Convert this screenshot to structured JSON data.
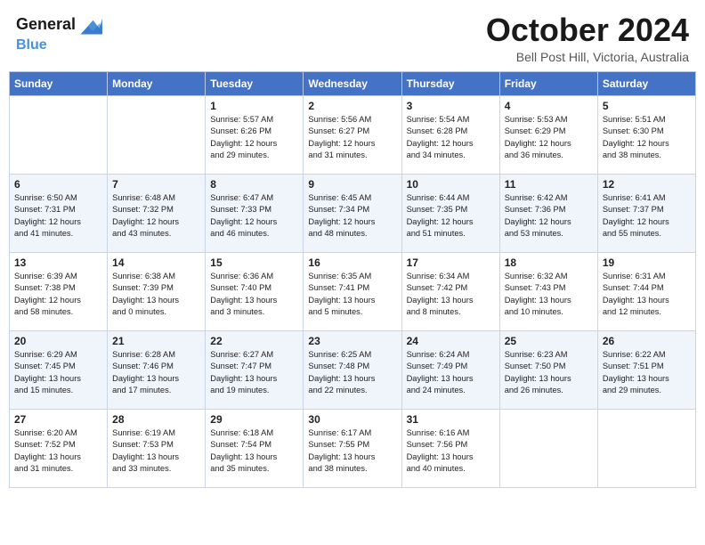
{
  "logo": {
    "line1": "General",
    "line2": "Blue"
  },
  "header": {
    "month": "October 2024",
    "location": "Bell Post Hill, Victoria, Australia"
  },
  "days_of_week": [
    "Sunday",
    "Monday",
    "Tuesday",
    "Wednesday",
    "Thursday",
    "Friday",
    "Saturday"
  ],
  "weeks": [
    [
      {
        "day": "",
        "info": ""
      },
      {
        "day": "",
        "info": ""
      },
      {
        "day": "1",
        "info": "Sunrise: 5:57 AM\nSunset: 6:26 PM\nDaylight: 12 hours\nand 29 minutes."
      },
      {
        "day": "2",
        "info": "Sunrise: 5:56 AM\nSunset: 6:27 PM\nDaylight: 12 hours\nand 31 minutes."
      },
      {
        "day": "3",
        "info": "Sunrise: 5:54 AM\nSunset: 6:28 PM\nDaylight: 12 hours\nand 34 minutes."
      },
      {
        "day": "4",
        "info": "Sunrise: 5:53 AM\nSunset: 6:29 PM\nDaylight: 12 hours\nand 36 minutes."
      },
      {
        "day": "5",
        "info": "Sunrise: 5:51 AM\nSunset: 6:30 PM\nDaylight: 12 hours\nand 38 minutes."
      }
    ],
    [
      {
        "day": "6",
        "info": "Sunrise: 6:50 AM\nSunset: 7:31 PM\nDaylight: 12 hours\nand 41 minutes."
      },
      {
        "day": "7",
        "info": "Sunrise: 6:48 AM\nSunset: 7:32 PM\nDaylight: 12 hours\nand 43 minutes."
      },
      {
        "day": "8",
        "info": "Sunrise: 6:47 AM\nSunset: 7:33 PM\nDaylight: 12 hours\nand 46 minutes."
      },
      {
        "day": "9",
        "info": "Sunrise: 6:45 AM\nSunset: 7:34 PM\nDaylight: 12 hours\nand 48 minutes."
      },
      {
        "day": "10",
        "info": "Sunrise: 6:44 AM\nSunset: 7:35 PM\nDaylight: 12 hours\nand 51 minutes."
      },
      {
        "day": "11",
        "info": "Sunrise: 6:42 AM\nSunset: 7:36 PM\nDaylight: 12 hours\nand 53 minutes."
      },
      {
        "day": "12",
        "info": "Sunrise: 6:41 AM\nSunset: 7:37 PM\nDaylight: 12 hours\nand 55 minutes."
      }
    ],
    [
      {
        "day": "13",
        "info": "Sunrise: 6:39 AM\nSunset: 7:38 PM\nDaylight: 12 hours\nand 58 minutes."
      },
      {
        "day": "14",
        "info": "Sunrise: 6:38 AM\nSunset: 7:39 PM\nDaylight: 13 hours\nand 0 minutes."
      },
      {
        "day": "15",
        "info": "Sunrise: 6:36 AM\nSunset: 7:40 PM\nDaylight: 13 hours\nand 3 minutes."
      },
      {
        "day": "16",
        "info": "Sunrise: 6:35 AM\nSunset: 7:41 PM\nDaylight: 13 hours\nand 5 minutes."
      },
      {
        "day": "17",
        "info": "Sunrise: 6:34 AM\nSunset: 7:42 PM\nDaylight: 13 hours\nand 8 minutes."
      },
      {
        "day": "18",
        "info": "Sunrise: 6:32 AM\nSunset: 7:43 PM\nDaylight: 13 hours\nand 10 minutes."
      },
      {
        "day": "19",
        "info": "Sunrise: 6:31 AM\nSunset: 7:44 PM\nDaylight: 13 hours\nand 12 minutes."
      }
    ],
    [
      {
        "day": "20",
        "info": "Sunrise: 6:29 AM\nSunset: 7:45 PM\nDaylight: 13 hours\nand 15 minutes."
      },
      {
        "day": "21",
        "info": "Sunrise: 6:28 AM\nSunset: 7:46 PM\nDaylight: 13 hours\nand 17 minutes."
      },
      {
        "day": "22",
        "info": "Sunrise: 6:27 AM\nSunset: 7:47 PM\nDaylight: 13 hours\nand 19 minutes."
      },
      {
        "day": "23",
        "info": "Sunrise: 6:25 AM\nSunset: 7:48 PM\nDaylight: 13 hours\nand 22 minutes."
      },
      {
        "day": "24",
        "info": "Sunrise: 6:24 AM\nSunset: 7:49 PM\nDaylight: 13 hours\nand 24 minutes."
      },
      {
        "day": "25",
        "info": "Sunrise: 6:23 AM\nSunset: 7:50 PM\nDaylight: 13 hours\nand 26 minutes."
      },
      {
        "day": "26",
        "info": "Sunrise: 6:22 AM\nSunset: 7:51 PM\nDaylight: 13 hours\nand 29 minutes."
      }
    ],
    [
      {
        "day": "27",
        "info": "Sunrise: 6:20 AM\nSunset: 7:52 PM\nDaylight: 13 hours\nand 31 minutes."
      },
      {
        "day": "28",
        "info": "Sunrise: 6:19 AM\nSunset: 7:53 PM\nDaylight: 13 hours\nand 33 minutes."
      },
      {
        "day": "29",
        "info": "Sunrise: 6:18 AM\nSunset: 7:54 PM\nDaylight: 13 hours\nand 35 minutes."
      },
      {
        "day": "30",
        "info": "Sunrise: 6:17 AM\nSunset: 7:55 PM\nDaylight: 13 hours\nand 38 minutes."
      },
      {
        "day": "31",
        "info": "Sunrise: 6:16 AM\nSunset: 7:56 PM\nDaylight: 13 hours\nand 40 minutes."
      },
      {
        "day": "",
        "info": ""
      },
      {
        "day": "",
        "info": ""
      }
    ]
  ]
}
